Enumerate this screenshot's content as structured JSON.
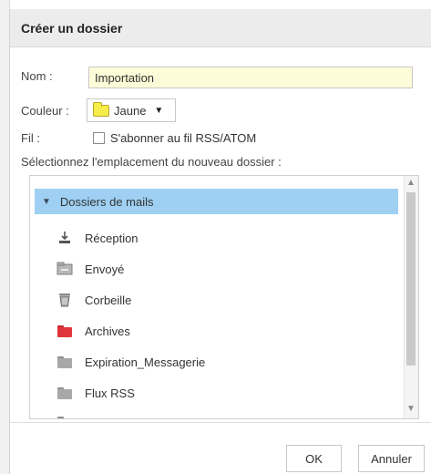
{
  "dialog": {
    "title": "Créer un dossier",
    "name_label": "Nom :",
    "name_value": "Importation",
    "color_label": "Couleur :",
    "color_value": "Jaune",
    "feed_label": "Fil :",
    "feed_checkbox_label": "S'abonner au fil RSS/ATOM",
    "location_prompt": "Sélectionnez l'emplacement du nouveau dossier :",
    "tree": {
      "root_label": "Dossiers de mails",
      "items": [
        {
          "label": "Réception",
          "icon": "inbox-icon"
        },
        {
          "label": "Envoyé",
          "icon": "sent-icon"
        },
        {
          "label": "Corbeille",
          "icon": "trash-icon"
        },
        {
          "label": "Archives",
          "icon": "folder-red-icon"
        },
        {
          "label": "Expiration_Messagerie",
          "icon": "folder-grey-icon"
        },
        {
          "label": "Flux RSS",
          "icon": "folder-grey-icon"
        }
      ]
    },
    "buttons": {
      "ok": "OK",
      "cancel": "Annuler"
    }
  },
  "colors": {
    "selection": "#9fd0f3",
    "input_bg": "#fdfcd8",
    "folder_yellow": "#f6ec4a",
    "folder_red": "#e0363b",
    "folder_grey": "#a8a8a8"
  }
}
